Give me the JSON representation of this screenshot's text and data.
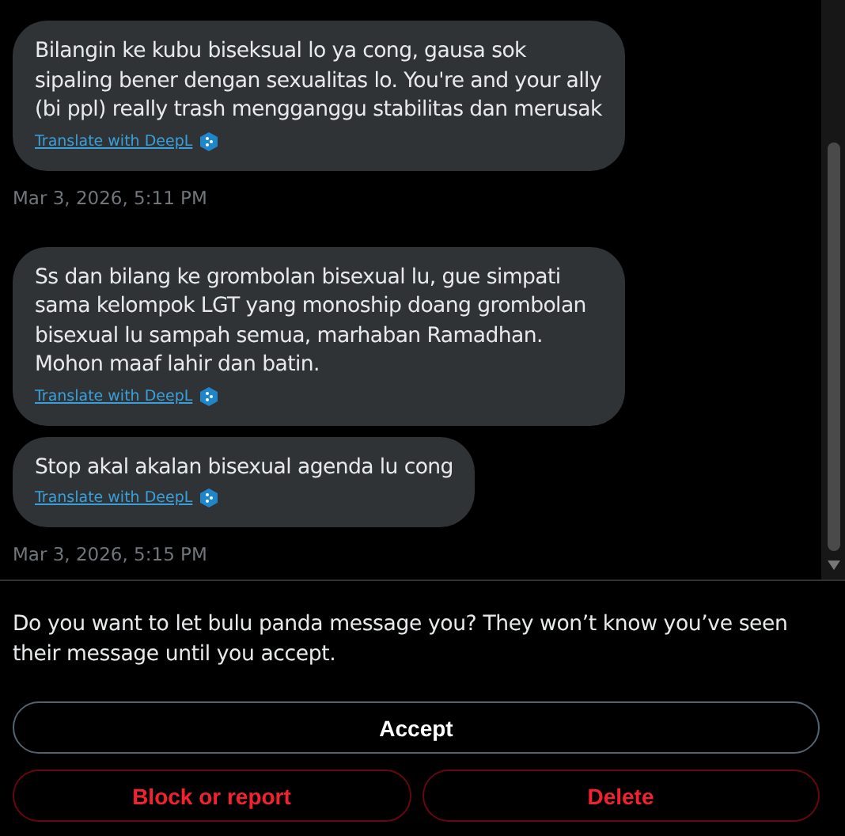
{
  "conversation": [
    {
      "kind": "message",
      "text": "Bilangin ke kubu biseksual lo ya cong, gausa sok sipaling bener dengan sexualitas lo. You're and your ally (bi ppl) really trash mengganggu stabilitas dan merusak",
      "translate_link": "Translate with DeepL"
    },
    {
      "kind": "timestamp",
      "text": "Mar 3, 2026, 5:11 PM"
    },
    {
      "kind": "message",
      "text": "Ss dan bilang ke grombolan bisexual lu, gue simpati sama kelompok LGT yang monoship doang grombolan bisexual lu sampah semua, marhaban Ramadhan. Mohon maaf lahir dan batin.",
      "translate_link": "Translate with DeepL"
    },
    {
      "kind": "message",
      "text": "Stop akal akalan bisexual agenda lu cong",
      "translate_link": "Translate with DeepL"
    },
    {
      "kind": "timestamp",
      "text": "Mar 3, 2026, 5:15 PM"
    }
  ],
  "request": {
    "prompt": "Do you want to let bulu panda message you? They won’t know you’ve seen their message until you accept.",
    "buttons": [
      {
        "kind": "primary",
        "label": "Accept"
      },
      {
        "kind": "danger",
        "label": "Block or report"
      },
      {
        "kind": "danger",
        "label": "Delete"
      }
    ]
  }
}
